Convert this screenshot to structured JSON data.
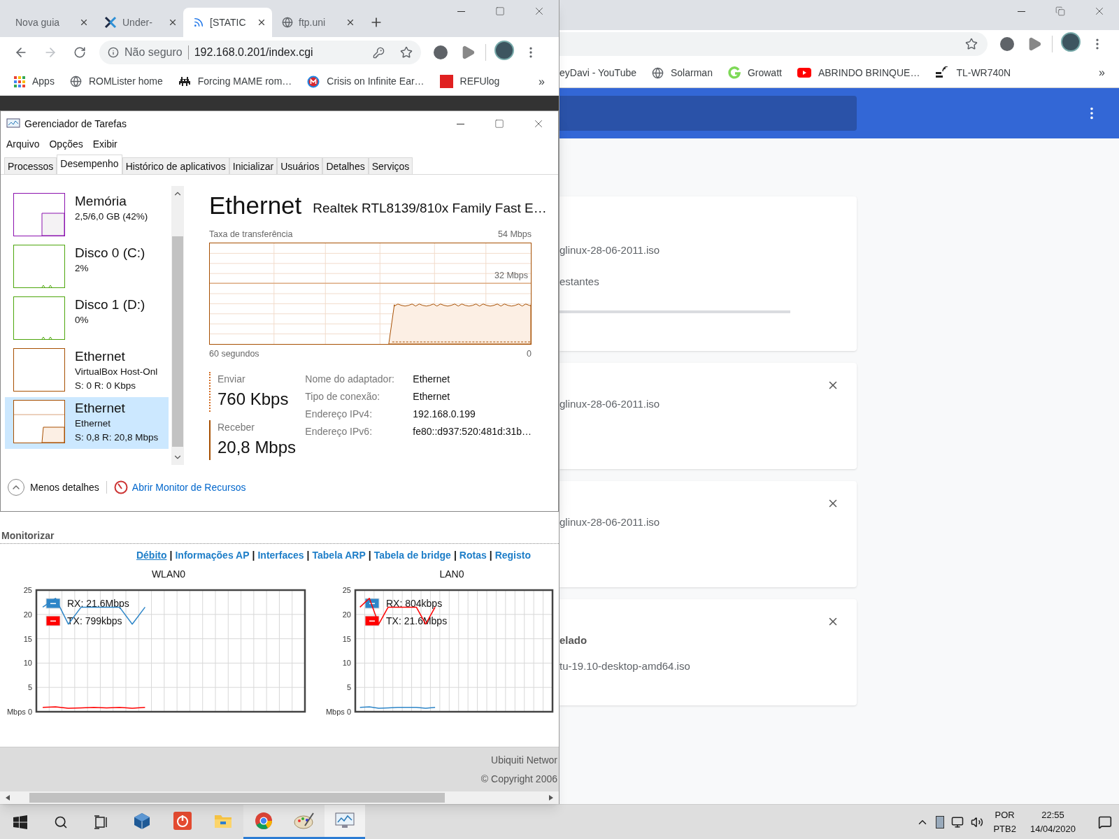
{
  "front_browser": {
    "tabs": [
      {
        "title": "Nova guia",
        "selected": false
      },
      {
        "title": "Under-",
        "selected": false
      },
      {
        "title": "[STATIC",
        "selected": true
      },
      {
        "title": "ftp.uni",
        "selected": false
      }
    ],
    "nav": [
      {
        "kind": "back",
        "disabled": false
      },
      {
        "kind": "forward",
        "disabled": true
      },
      {
        "kind": "reload",
        "disabled": false
      }
    ],
    "omnibox": {
      "security": "Não seguro",
      "url": "192.168.0.201/index.cgi"
    },
    "bookmarks": [
      {
        "label": "Apps"
      },
      {
        "label": "ROMLister home"
      },
      {
        "label": "Forcing MAME rom…"
      },
      {
        "label": "Crisis on Infinite Ear…"
      },
      {
        "label": "REFUlog"
      }
    ],
    "bookmarks_overflow": "»"
  },
  "task_manager": {
    "title": "Gerenciador de Tarefas",
    "menu": [
      "Arquivo",
      "Opções",
      "Exibir"
    ],
    "tabs": [
      {
        "label": "Processos",
        "selected": false
      },
      {
        "label": "Desempenho",
        "selected": true
      },
      {
        "label": "Histórico de aplicativos",
        "selected": false
      },
      {
        "label": "Inicializar",
        "selected": false
      },
      {
        "label": "Usuários",
        "selected": false
      },
      {
        "label": "Detalhes",
        "selected": false
      },
      {
        "label": "Serviços",
        "selected": false
      }
    ],
    "devices": [
      {
        "kind": "memory",
        "name": "Memória",
        "subtitle": "2,5/6,0 GB (42%)",
        "color": "#8b12ae",
        "selected": false
      },
      {
        "kind": "disk",
        "name": "Disco 0 (C:)",
        "subtitle": "2%",
        "color": "#4da60c",
        "selected": false
      },
      {
        "kind": "disk",
        "name": "Disco 1 (D:)",
        "subtitle": "0%",
        "color": "#4da60c",
        "selected": false
      },
      {
        "kind": "ethernet",
        "name": "Ethernet",
        "subtitle": "VirtualBox Host-Onl",
        "detail": "S: 0 R: 0 Kbps",
        "color": "#a74f01",
        "selected": false
      },
      {
        "kind": "ethernet",
        "name": "Ethernet",
        "subtitle": "Ethernet",
        "detail": "S: 0,8 R: 20,8 Mbps",
        "color": "#a74f01",
        "selected": true
      }
    ],
    "panel": {
      "title": "Ethernet",
      "adapter": "Realtek RTL8139/810x Family Fast E…",
      "graph_label": "Taxa de transferência",
      "graph_max": "54 Mbps",
      "graph_mid": "32 Mbps",
      "graph_start": "60 segundos",
      "graph_end": "0",
      "send_label": "Enviar",
      "send_value": "760 Kbps",
      "receive_label": "Receber",
      "receive_value": "20,8 Mbps",
      "properties": [
        {
          "label": "Nome do adaptador:",
          "value": "Ethernet"
        },
        {
          "label": "Tipo de conexão:",
          "value": "Ethernet"
        },
        {
          "label": "Endereço IPv4:",
          "value": "192.168.0.199"
        },
        {
          "label": "Endereço IPv6:",
          "value": "fe80::d937:520:481d:31b…"
        }
      ]
    },
    "footer": {
      "less_details": "Menos detalhes",
      "resource_monitor": "Abrir Monitor de Recursos"
    }
  },
  "router_page": {
    "section": "Monitorizar",
    "separator": "|",
    "links": [
      {
        "label": "Débito",
        "selected": true
      },
      {
        "label": "Informações AP",
        "selected": false
      },
      {
        "label": "Interfaces",
        "selected": false
      },
      {
        "label": "Tabela ARP",
        "selected": false
      },
      {
        "label": "Tabela de bridge",
        "selected": false
      },
      {
        "label": "Rotas",
        "selected": false
      },
      {
        "label": "Registo",
        "selected": false
      }
    ],
    "charts": [
      {
        "title": "WLAN0",
        "chart_data": {
          "type": "line",
          "grid": true,
          "legend": true,
          "categories": [
            null,
            null,
            null,
            null,
            null,
            null,
            null,
            null,
            null,
            null,
            null,
            null,
            null,
            null,
            null,
            null,
            null,
            null,
            null,
            null,
            null
          ],
          "ylim": [
            0,
            25
          ],
          "yticks": [
            {
              "value": 0,
              "label": "Mbps 0"
            },
            5,
            10,
            15,
            20,
            25
          ],
          "series": [
            {
              "name": "RX: 21.6Mbps",
              "color": "#2e86c8",
              "values": [
                21.5,
                23.3,
                18,
                21.5,
                21.5,
                21.5,
                21.5,
                18,
                21.5,
                null,
                null,
                null,
                null,
                null,
                null,
                null,
                null,
                null,
                null,
                null,
                null
              ]
            },
            {
              "name": "TX: 799kbps",
              "color": "#ff0000",
              "values": [
                0.9,
                1.0,
                0.7,
                0.8,
                0.9,
                0.8,
                0.9,
                0.7,
                0.9,
                null,
                null,
                null,
                null,
                null,
                null,
                null,
                null,
                null,
                null,
                null,
                null
              ]
            }
          ]
        }
      },
      {
        "title": "LAN0",
        "chart_data": {
          "type": "line",
          "grid": true,
          "legend": true,
          "categories": [
            null,
            null,
            null,
            null,
            null,
            null,
            null,
            null,
            null,
            null,
            null,
            null,
            null,
            null,
            null,
            null,
            null,
            null,
            null,
            null,
            null
          ],
          "ylim": [
            0,
            25
          ],
          "yticks": [
            {
              "value": 0,
              "label": "Mbps 0"
            },
            5,
            10,
            15,
            20,
            25
          ],
          "series": [
            {
              "name": "RX: 804kbps",
              "color": "#2e86c8",
              "values": [
                0.9,
                1.0,
                0.7,
                0.8,
                0.9,
                0.9,
                0.9,
                0.7,
                0.9,
                null,
                null,
                null,
                null,
                null,
                null,
                null,
                null,
                null,
                null,
                null,
                null
              ]
            },
            {
              "name": "TX: 21.6Mbps",
              "color": "#ff0000",
              "values": [
                21.5,
                23.3,
                18,
                21.5,
                21.5,
                21.5,
                21.5,
                18,
                21.5,
                null,
                null,
                null,
                null,
                null,
                null,
                null,
                null,
                null,
                null,
                null,
                null
              ]
            }
          ]
        }
      }
    ],
    "footer": [
      "Ubiquiti Networ",
      "© Copyright 2006"
    ]
  },
  "back_browser": {
    "bookmarks": [
      {
        "label": "eyDavi - YouTube"
      },
      {
        "label": "Solarman"
      },
      {
        "label": "Growatt"
      },
      {
        "label": "ABRINDO BRINQUE…"
      },
      {
        "label": "TL-WR740N"
      }
    ],
    "bookmarks_overflow": "»",
    "downloads": [
      {
        "lines": [
          {
            "kind": "file",
            "text": "glinux-28-06-2011.iso"
          },
          {
            "kind": "status",
            "text": "estantes"
          }
        ],
        "downloading": true,
        "closable": false
      },
      {
        "lines": [
          {
            "kind": "file",
            "text": "glinux-28-06-2011.iso"
          }
        ],
        "downloading": false,
        "closable": true
      },
      {
        "lines": [
          {
            "kind": "file",
            "text": "glinux-28-06-2011.iso"
          }
        ],
        "downloading": false,
        "closable": true
      },
      {
        "lines": [
          {
            "kind": "heading",
            "text": "elado"
          },
          {
            "kind": "file",
            "text": "tu-19.10-desktop-amd64.iso"
          }
        ],
        "downloading": false,
        "closable": true
      }
    ]
  },
  "taskbar": {
    "apps": [
      {
        "kind": "virtualbox",
        "running": false,
        "selected": false
      },
      {
        "kind": "power",
        "running": false,
        "selected": false
      },
      {
        "kind": "folder",
        "running": false,
        "selected": false
      },
      {
        "kind": "chrome",
        "running": true,
        "selected": false
      },
      {
        "kind": "paint",
        "running": true,
        "selected": false
      },
      {
        "kind": "taskmgr",
        "running": true,
        "selected": true
      }
    ],
    "tray": {
      "language": "POR",
      "layout": "PTB2",
      "time": "22:55",
      "date": "14/04/2020"
    }
  }
}
